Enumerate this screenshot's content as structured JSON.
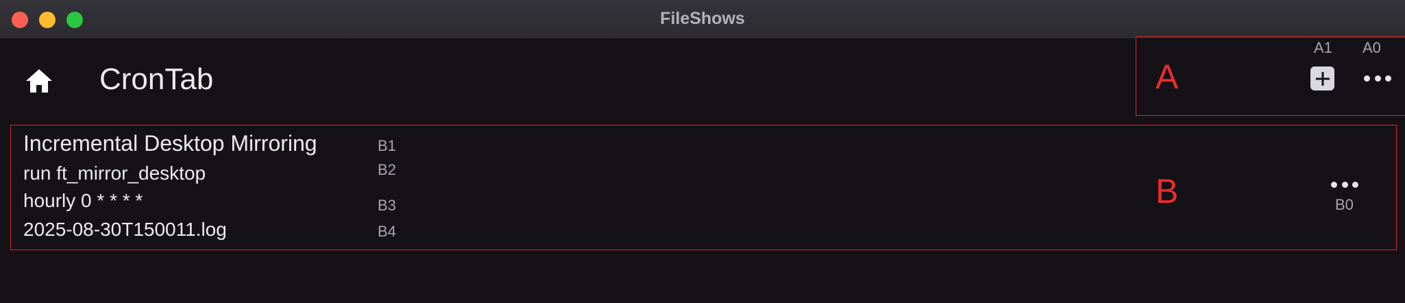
{
  "window": {
    "title": "FileShows"
  },
  "header": {
    "title": "CronTab"
  },
  "annotations": {
    "region_a": "A",
    "region_b": "B",
    "a0": "A0",
    "a1": "A1",
    "b0": "B0",
    "b1": "B1",
    "b2": "B2",
    "b3": "B3",
    "b4": "B4"
  },
  "job": {
    "name": "Incremental Desktop Mirroring",
    "command": "run ft_mirror_desktop",
    "schedule": "hourly 0 * * * *",
    "log": "2025-08-30T150011.log"
  },
  "icons": {
    "home": "home-icon",
    "add": "plus-icon",
    "more": "more-horizontal-icon"
  },
  "colors": {
    "background": "#141217",
    "titlebar": "#2f2e33",
    "annotation": "#ee2b2b",
    "text": "#ecebf0"
  }
}
